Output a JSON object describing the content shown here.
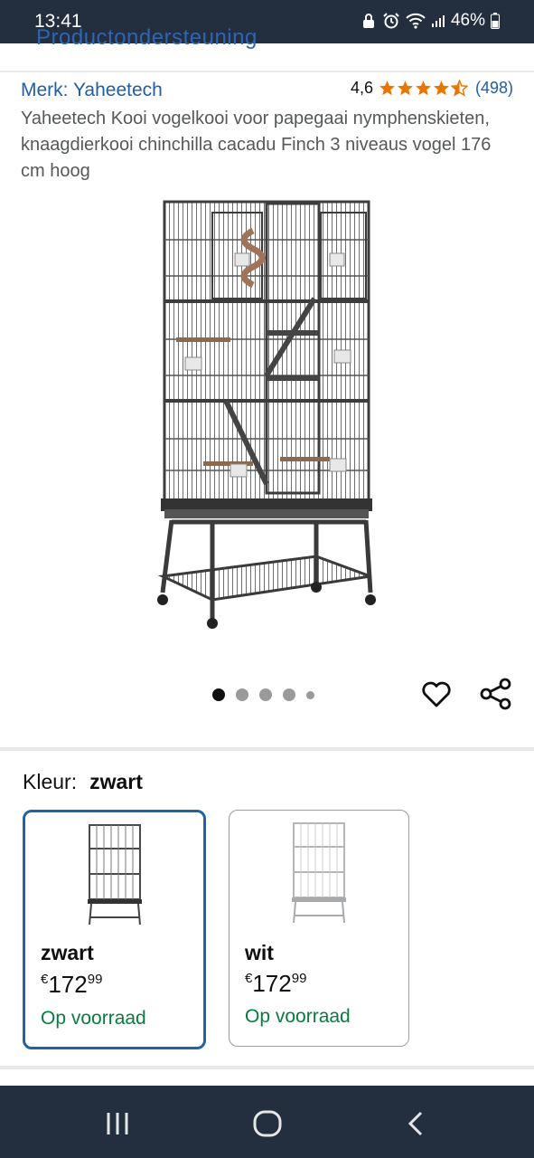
{
  "status_bar": {
    "time": "13:41",
    "battery": "46%"
  },
  "header": {
    "clipped_link": "Productondersteuning"
  },
  "product": {
    "brand": "Merk: Yaheetech",
    "rating_value": "4,6",
    "rating_stars": 4.5,
    "rating_count": "(498)",
    "title": "Yaheetech Kooi vogelkooi voor papegaai nymphenskieten, knaagdierkooi chinchilla cacadu Finch 3 niveaus vogel 176 cm hoog"
  },
  "carousel": {
    "image_count": 5,
    "active_index": 0
  },
  "colors": {
    "label": "Kleur:",
    "selected": "zwart",
    "options": [
      {
        "name": "zwart",
        "currency": "€",
        "price_whole": "172",
        "price_fraction": "99",
        "stock": "Op voorraad",
        "image_color": "#4a4a4a"
      },
      {
        "name": "wit",
        "currency": "€",
        "price_whole": "172",
        "price_fraction": "99",
        "stock": "Op voorraad",
        "image_color": "#c4c6c8"
      }
    ]
  },
  "theme": {
    "bar_color": "#232f3e",
    "link_color": "#1f5ea8",
    "star_color": "#e77600",
    "stock_color": "#067d3d",
    "selected_border": "#2162a1"
  }
}
